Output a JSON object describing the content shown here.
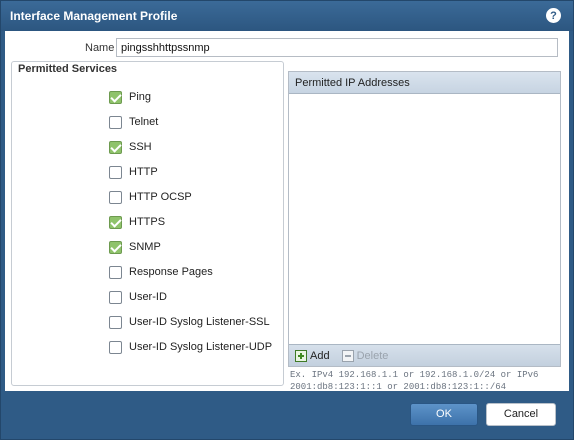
{
  "window": {
    "title": "Interface Management Profile",
    "help_icon": "?"
  },
  "name_field": {
    "label": "Name",
    "value": "pingsshhttpssnmp"
  },
  "permitted_services": {
    "legend": "Permitted Services",
    "items": [
      {
        "label": "Ping",
        "checked": true
      },
      {
        "label": "Telnet",
        "checked": false
      },
      {
        "label": "SSH",
        "checked": true
      },
      {
        "label": "HTTP",
        "checked": false
      },
      {
        "label": "HTTP OCSP",
        "checked": false
      },
      {
        "label": "HTTPS",
        "checked": true
      },
      {
        "label": "SNMP",
        "checked": true
      },
      {
        "label": "Response Pages",
        "checked": false
      },
      {
        "label": "User-ID",
        "checked": false
      },
      {
        "label": "User-ID Syslog Listener-SSL",
        "checked": false
      },
      {
        "label": "User-ID Syslog Listener-UDP",
        "checked": false
      }
    ]
  },
  "permitted_ip": {
    "header": "Permitted IP Addresses",
    "add_label": "Add",
    "delete_label": "Delete",
    "hint": "Ex. IPv4 192.168.1.1 or 192.168.1.0/24 or IPv6 2001:db8:123:1::1 or 2001:db8:123:1::/64"
  },
  "buttons": {
    "ok_label": "OK",
    "cancel_label": "Cancel"
  },
  "colors": {
    "frame": "#2f5b86",
    "checkbox_checked": "#8fc36b",
    "ok_button": "#3d72aa"
  }
}
